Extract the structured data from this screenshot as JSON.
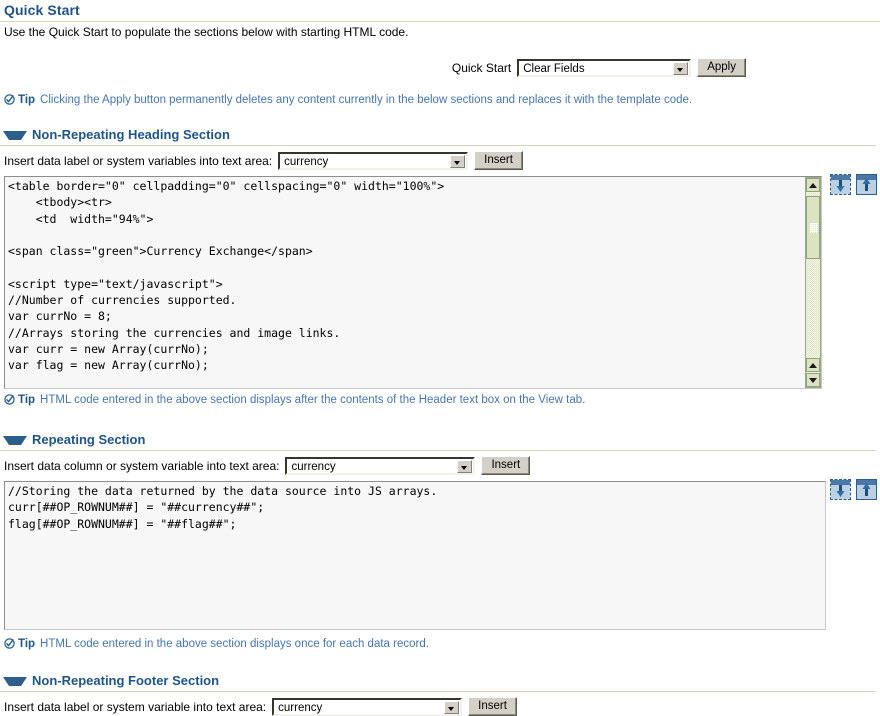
{
  "page": {
    "title": "Quick Start",
    "intro": "Use the Quick Start to populate the sections below with starting HTML code."
  },
  "quick_start": {
    "label": "Quick Start",
    "selected": "Clear Fields",
    "options": [
      "Clear Fields"
    ],
    "apply_label": "Apply",
    "dropdown_icon": "chevron-down-icon"
  },
  "tips": {
    "word": "Tip",
    "icon": "check-circle-icon",
    "apply_warning": "Clicking the Apply button permanently deletes any content currently in the below sections and replaces it with the template code.",
    "heading_section": "HTML code entered in the above section displays after the contents of the Header text box on the View tab.",
    "repeating_section": "HTML code entered in the above section displays once for each data record."
  },
  "sections": {
    "heading": {
      "title": "Non-Repeating Heading Section",
      "collapse_icon": "triangle-down-icon",
      "insert_label": "Insert data label or system variables into text area:",
      "selected_variable": "currency",
      "insert_button": "Insert",
      "code": "<table border=\"0\" cellpadding=\"0\" cellspacing=\"0\" width=\"100%\">\n    <tbody><tr>\n    <td  width=\"94%\">\n\n<span class=\"green\">Currency Exchange</span>\n\n<script type=\"text/javascript\">\n//Number of currencies supported.\nvar currNo = 8;\n//Arrays storing the currencies and image links.\nvar curr = new Array(currNo);\nvar flag = new Array(currNo);\n\n//Setting the flags according to the selection in the drop-down list.",
      "expand_icon": "expand-editor-icon",
      "restore_icon": "restore-editor-icon",
      "scrollbar": "vertical-scrollbar"
    },
    "repeating": {
      "title": "Repeating Section",
      "collapse_icon": "triangle-down-icon",
      "insert_label": "Insert data column or system variable into text area:",
      "selected_variable": "currency",
      "insert_button": "Insert",
      "code": "//Storing the data returned by the data source into JS arrays.\ncurr[##OP_ROWNUM##] = \"##currency##\";\nflag[##OP_ROWNUM##] = \"##flag##\";",
      "expand_icon": "expand-editor-icon",
      "restore_icon": "restore-editor-icon"
    },
    "footer": {
      "title": "Non-Repeating Footer Section",
      "collapse_icon": "triangle-down-icon",
      "insert_label": "Insert data label or system variable into text area:",
      "selected_variable": "currency",
      "insert_button": "Insert"
    }
  },
  "colors": {
    "heading_blue": "#1F5582",
    "tip_blue": "#4876A8",
    "rule": "#D6D6BE",
    "textarea_bg": "#F7F7F7",
    "scrollbar_green": "#DCE3C0"
  }
}
